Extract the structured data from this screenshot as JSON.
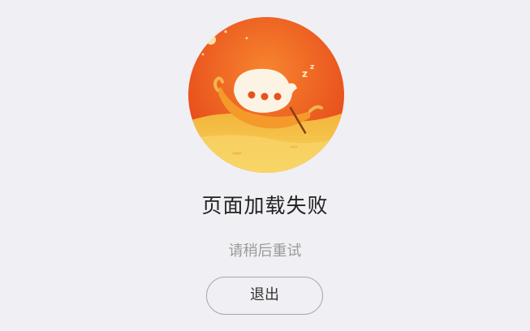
{
  "error": {
    "illustration_icon": "sleeping-chat-bubble-boat-illustration",
    "title": "页面加载失败",
    "subtitle": "请稍后重试",
    "exit_label": "退出"
  },
  "colors": {
    "background": "#f0eff4",
    "sky_top": "#f5732a",
    "sky_bottom": "#e8461a",
    "sand": "#f6c649",
    "title_text": "#222222",
    "subtitle_text": "#9a9a9a",
    "button_border": "#a6a6a6"
  }
}
